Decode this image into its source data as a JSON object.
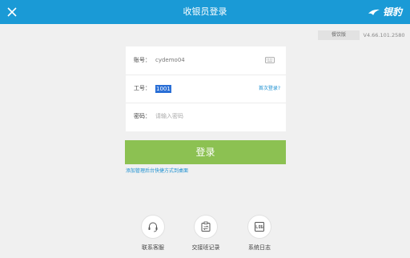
{
  "header": {
    "title": "收银员登录",
    "brand": "银豹",
    "close_icon": "close-icon"
  },
  "meta": {
    "edition": "餐饮版",
    "version": "V4.66.101.2580"
  },
  "form": {
    "account": {
      "label": "账号：",
      "value": "cydemo04",
      "icon": "keyboard-icon"
    },
    "employee": {
      "label": "工号：",
      "value": "1001",
      "link": "首次登录?"
    },
    "password": {
      "label": "密码：",
      "placeholder": "请输入密码"
    }
  },
  "login_label": "登录",
  "shortcut_link": "添加管理后台快捷方式到桌面",
  "actions": [
    {
      "label": "联系客服",
      "icon": "headset-icon"
    },
    {
      "label": "交接班记录",
      "icon": "handover-record-icon"
    },
    {
      "label": "系统日志",
      "icon": "log-icon"
    }
  ],
  "colors": {
    "header": "#1a9ad6",
    "login_button": "#8cc152",
    "link": "#1a8fd1",
    "selection": "#2a6fd6"
  }
}
